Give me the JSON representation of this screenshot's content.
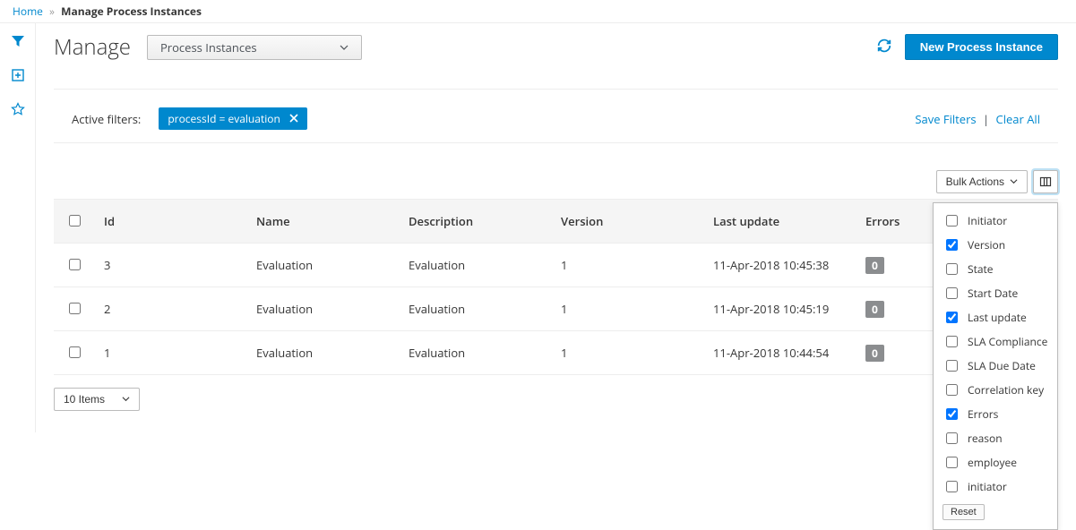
{
  "breadcrumb": {
    "home": "Home",
    "current": "Manage Process Instances"
  },
  "header": {
    "title": "Manage",
    "selector": "Process Instances",
    "new_btn": "New Process Instance"
  },
  "filter_bar": {
    "label": "Active filters:",
    "chip": "processId = evaluation",
    "save": "Save Filters",
    "clear": "Clear All"
  },
  "toolbar": {
    "bulk": "Bulk Actions"
  },
  "table": {
    "headers": {
      "id": "Id",
      "name": "Name",
      "desc": "Description",
      "version": "Version",
      "updated": "Last update",
      "errors": "Errors"
    },
    "rows": [
      {
        "id": "3",
        "name": "Evaluation",
        "desc": "Evaluation",
        "version": "1",
        "updated": "11-Apr-2018 10:45:38",
        "errors": "0"
      },
      {
        "id": "2",
        "name": "Evaluation",
        "desc": "Evaluation",
        "version": "1",
        "updated": "11-Apr-2018 10:45:19",
        "errors": "0"
      },
      {
        "id": "1",
        "name": "Evaluation",
        "desc": "Evaluation",
        "version": "1",
        "updated": "11-Apr-2018 10:44:54",
        "errors": "0"
      }
    ]
  },
  "footer": {
    "items": "10 Items"
  },
  "column_menu": {
    "options": [
      {
        "label": "Initiator",
        "checked": false
      },
      {
        "label": "Version",
        "checked": true
      },
      {
        "label": "State",
        "checked": false
      },
      {
        "label": "Start Date",
        "checked": false
      },
      {
        "label": "Last update",
        "checked": true
      },
      {
        "label": "SLA Compliance",
        "checked": false
      },
      {
        "label": "SLA Due Date",
        "checked": false
      },
      {
        "label": "Correlation key",
        "checked": false
      },
      {
        "label": "Errors",
        "checked": true
      },
      {
        "label": "reason",
        "checked": false
      },
      {
        "label": "employee",
        "checked": false
      },
      {
        "label": "initiator",
        "checked": false
      }
    ],
    "reset": "Reset"
  }
}
